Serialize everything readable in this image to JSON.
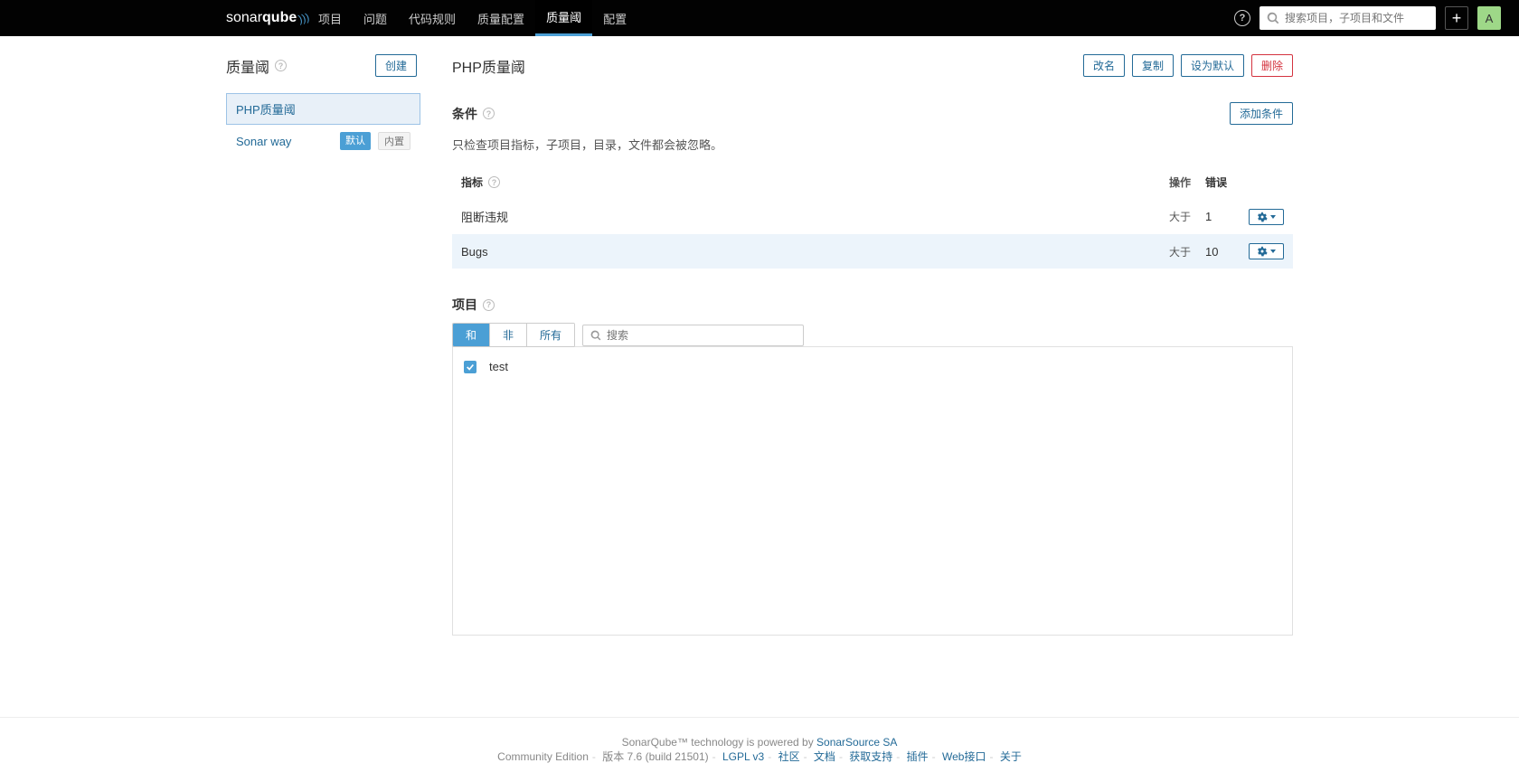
{
  "topbar": {
    "logo_a": "sonar",
    "logo_b": "qube",
    "nav": [
      "项目",
      "问题",
      "代码规则",
      "质量配置",
      "质量阈",
      "配置"
    ],
    "active_nav_index": 4,
    "search_placeholder": "搜索项目，子项目和文件",
    "avatar_letter": "A"
  },
  "sidebar": {
    "title": "质量阈",
    "create_btn": "创建",
    "gates": [
      {
        "name": "PHP质量阈",
        "selected": true,
        "badges": []
      },
      {
        "name": "Sonar way",
        "selected": false,
        "badges": [
          "默认",
          "内置"
        ]
      }
    ]
  },
  "content": {
    "title": "PHP质量阈",
    "actions": {
      "rename": "改名",
      "copy": "复制",
      "set_default": "设为默认",
      "delete": "删除"
    }
  },
  "conditions": {
    "title": "条件",
    "add_btn": "添加条件",
    "desc": "只检查项目指标，子项目，目录，文件都会被忽略。",
    "cols": {
      "metric": "指标",
      "op": "操作",
      "err": "错误"
    },
    "rows": [
      {
        "metric": "阻断违规",
        "op": "大于",
        "err": "1",
        "hover": false
      },
      {
        "metric": "Bugs",
        "op": "大于",
        "err": "10",
        "hover": true
      }
    ]
  },
  "projects": {
    "title": "项目",
    "tabs": [
      "和",
      "非",
      "所有"
    ],
    "active_tab_index": 0,
    "search_placeholder": "搜索",
    "rows": [
      {
        "name": "test",
        "checked": true
      }
    ]
  },
  "footer": {
    "line1_a": "SonarQube™ technology is powered by ",
    "line1_b": "SonarSource SA",
    "edition": "Community Edition",
    "version": "版本 7.6 (build 21501)",
    "links": [
      "LGPL v3",
      "社区",
      "文档",
      "获取支持",
      "插件",
      "Web接口",
      "关于"
    ]
  }
}
